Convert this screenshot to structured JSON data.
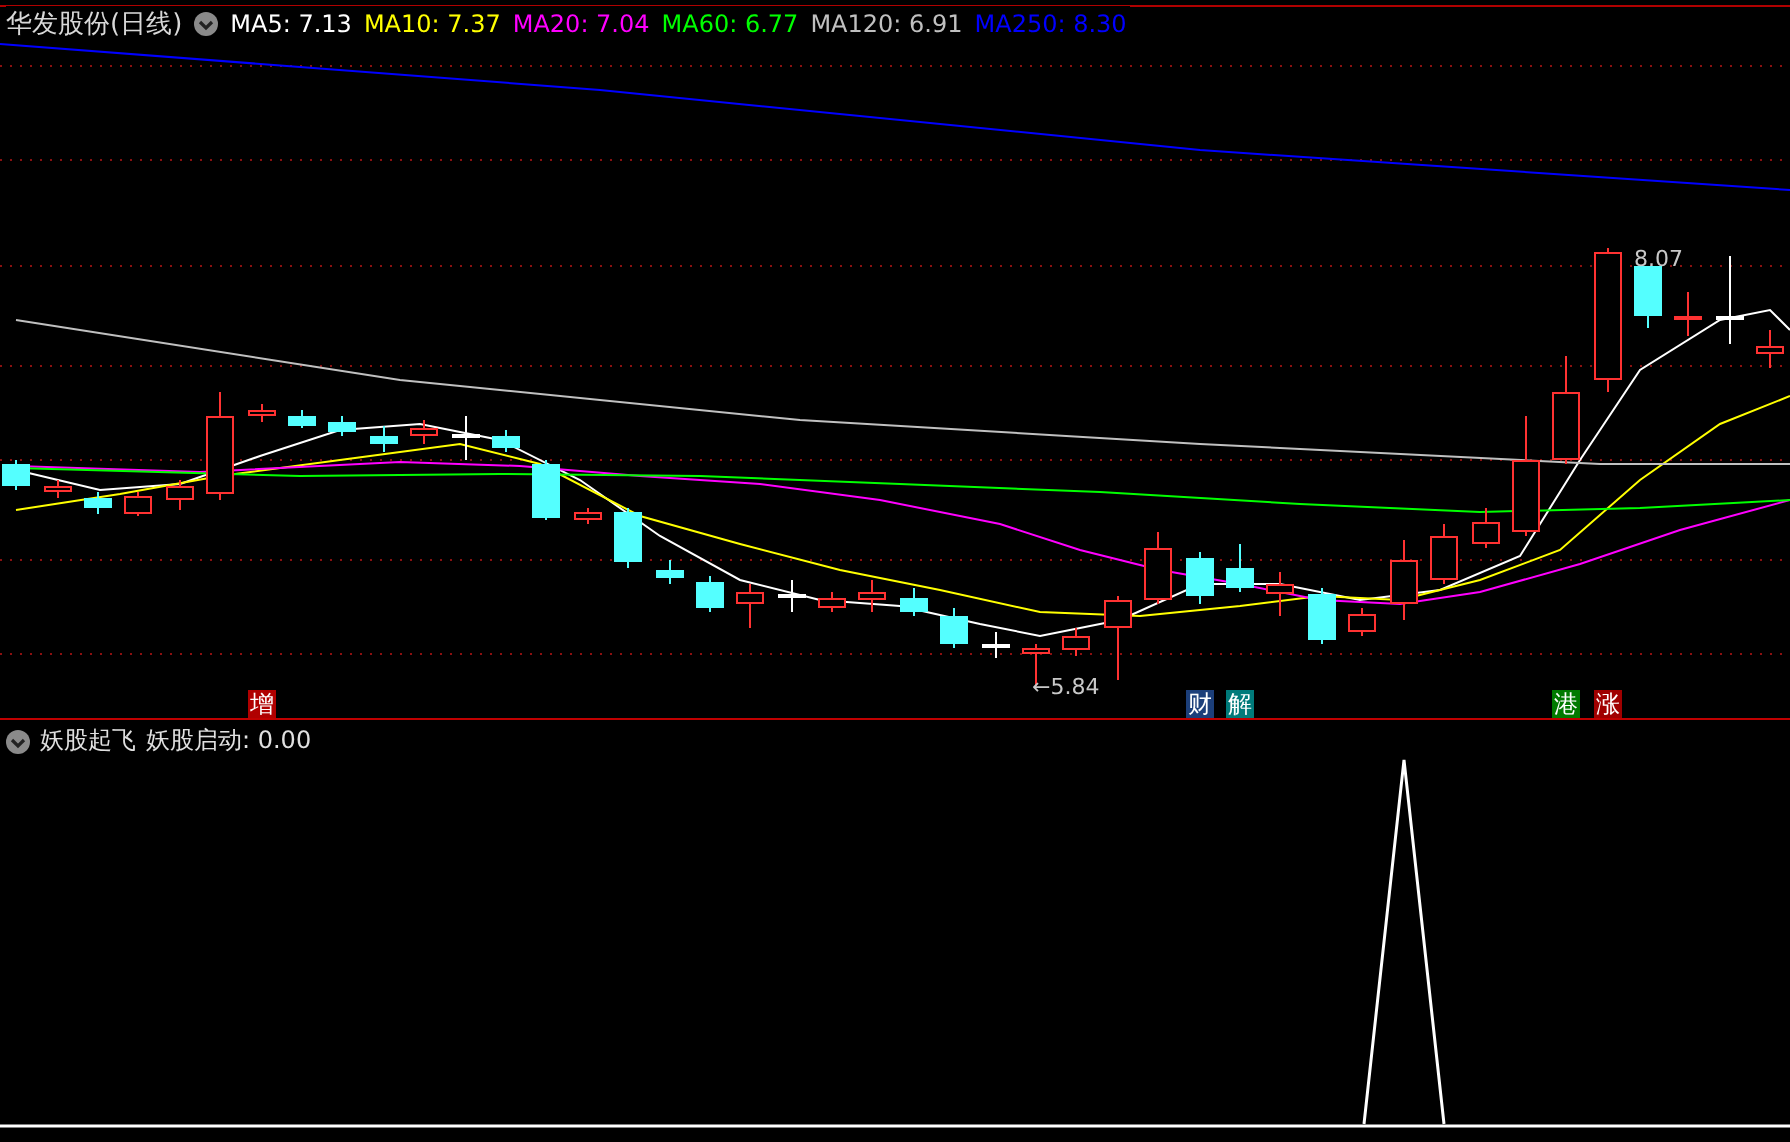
{
  "main_panel": {
    "title": "华发股份(日线)",
    "indicators": [
      {
        "label": "MA5: 7.13",
        "color": "#ffffff"
      },
      {
        "label": "MA10: 7.37",
        "color": "#ffff00"
      },
      {
        "label": "MA20: 7.04",
        "color": "#ff00ff"
      },
      {
        "label": "MA60: 6.77",
        "color": "#00ff00"
      },
      {
        "label": "MA120: 6.91",
        "color": "#c0c0c0"
      },
      {
        "label": "MA250: 8.30",
        "color": "#0000ff"
      }
    ],
    "high_marker": "8.07",
    "low_marker": "←5.84",
    "event_tags": [
      {
        "text": "增",
        "color": "#b00000"
      },
      {
        "text": "财",
        "color": "#1c3f7a"
      },
      {
        "text": "解",
        "color": "#007a7a"
      },
      {
        "text": "港",
        "color": "#007a00"
      },
      {
        "text": "涨",
        "color": "#a00000"
      }
    ]
  },
  "indicator_panel": {
    "title": "妖股起飞",
    "reading": "妖股启动: 0.00"
  }
}
